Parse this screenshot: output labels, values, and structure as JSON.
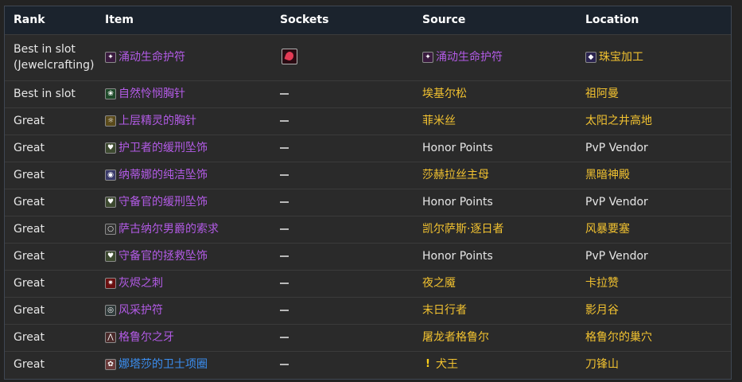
{
  "headers": {
    "rank": "Rank",
    "item": "Item",
    "sockets": "Sockets",
    "source": "Source",
    "location": "Location"
  },
  "rows": [
    {
      "rank1": "Best in slot",
      "rank2": "(Jewelcrafting)",
      "item": "涌动生命护符",
      "item_icon": "amulet-icon",
      "sockets": "red-socket",
      "source": "涌动生命护符",
      "source_icon": "amulet-icon",
      "location": "珠宝加工",
      "location_icon": "jewelcrafting-icon"
    },
    {
      "rank1": "Best in slot",
      "item": "自然怜悯胸针",
      "item_icon": "brooch-icon",
      "sockets": "—",
      "source": "埃基尔松",
      "location": "祖阿曼"
    },
    {
      "rank1": "Great",
      "item": "上层精灵的胸针",
      "item_icon": "brooch-icon",
      "sockets": "—",
      "source": "菲米丝",
      "location": "太阳之井高地"
    },
    {
      "rank1": "Great",
      "item": "护卫者的缓刑坠饰",
      "item_icon": "pendant-icon",
      "sockets": "—",
      "source": "Honor Points",
      "location": "PvP Vendor"
    },
    {
      "rank1": "Great",
      "item": "纳蒂娜的纯洁坠饰",
      "item_icon": "pendant-icon",
      "sockets": "—",
      "source": "莎赫拉丝主母",
      "location": "黑暗神殿"
    },
    {
      "rank1": "Great",
      "item": "守备官的缓刑坠饰",
      "item_icon": "pendant-icon",
      "sockets": "—",
      "source": "Honor Points",
      "location": "PvP Vendor"
    },
    {
      "rank1": "Great",
      "item": "萨古纳尔男爵的索求",
      "item_icon": "necklace-icon",
      "sockets": "—",
      "source": "凯尔萨斯·逐日者",
      "location": "风暴要塞"
    },
    {
      "rank1": "Great",
      "item": "守备官的拯救坠饰",
      "item_icon": "pendant-icon",
      "sockets": "—",
      "source": "Honor Points",
      "location": "PvP Vendor"
    },
    {
      "rank1": "Great",
      "item": "灰烬之刺",
      "item_icon": "necklace-icon",
      "sockets": "—",
      "source": "夜之魇",
      "location": "卡拉赞"
    },
    {
      "rank1": "Great",
      "item": "风采护符",
      "item_icon": "amulet-icon",
      "sockets": "—",
      "source": "末日行者",
      "location": "影月谷"
    },
    {
      "rank1": "Great",
      "item": "格鲁尔之牙",
      "item_icon": "fang-icon",
      "sockets": "—",
      "source": "屠龙者格鲁尔",
      "location": "格鲁尔的巢穴"
    },
    {
      "rank1": "Great",
      "item": "娜塔莎的卫士项圈",
      "item_icon": "collar-icon",
      "sockets": "—",
      "source": "犬王",
      "source_icon": "quest-icon",
      "location": "刀锋山"
    }
  ]
}
